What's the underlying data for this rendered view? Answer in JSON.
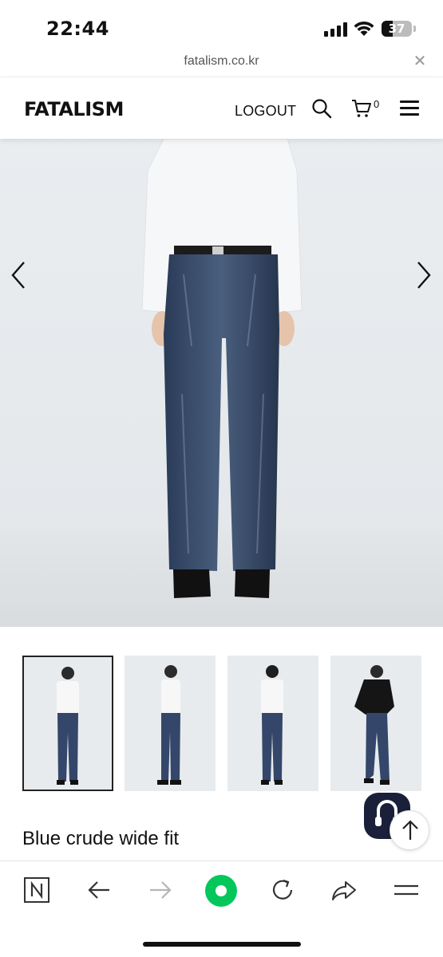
{
  "status_bar": {
    "time": "22:44",
    "battery": "37",
    "battery_level": 0.37
  },
  "url_bar": {
    "url": "fatalism.co.kr",
    "close_icon": "close-icon"
  },
  "header": {
    "logo": "FATALISM",
    "logout_label": "LOGOUT",
    "search_icon": "search-icon",
    "cart_icon": "cart-icon",
    "cart_count": "0",
    "menu_icon": "hamburger-menu-icon"
  },
  "gallery": {
    "prev_icon": "chevron-left-icon",
    "next_icon": "chevron-right-icon",
    "thumbnails": [
      {
        "view": "front",
        "active": true,
        "top": "white"
      },
      {
        "view": "side",
        "active": false,
        "top": "white"
      },
      {
        "view": "back",
        "active": false,
        "top": "white"
      },
      {
        "view": "front",
        "active": false,
        "top": "black"
      }
    ]
  },
  "product": {
    "title": "Blue crude wide fit"
  },
  "floating": {
    "chat_icon": "chat-icon",
    "scroll_top_icon": "arrow-up-icon"
  },
  "browser_toolbar": {
    "items": [
      "naver-home-icon",
      "back-icon",
      "forward-icon",
      "green-dot-icon",
      "reload-icon",
      "share-icon",
      "menu-icon"
    ]
  },
  "colors": {
    "accent_green": "#03c75a",
    "chat_bg": "#1a1f3a",
    "denim": "#2c3e5e"
  }
}
